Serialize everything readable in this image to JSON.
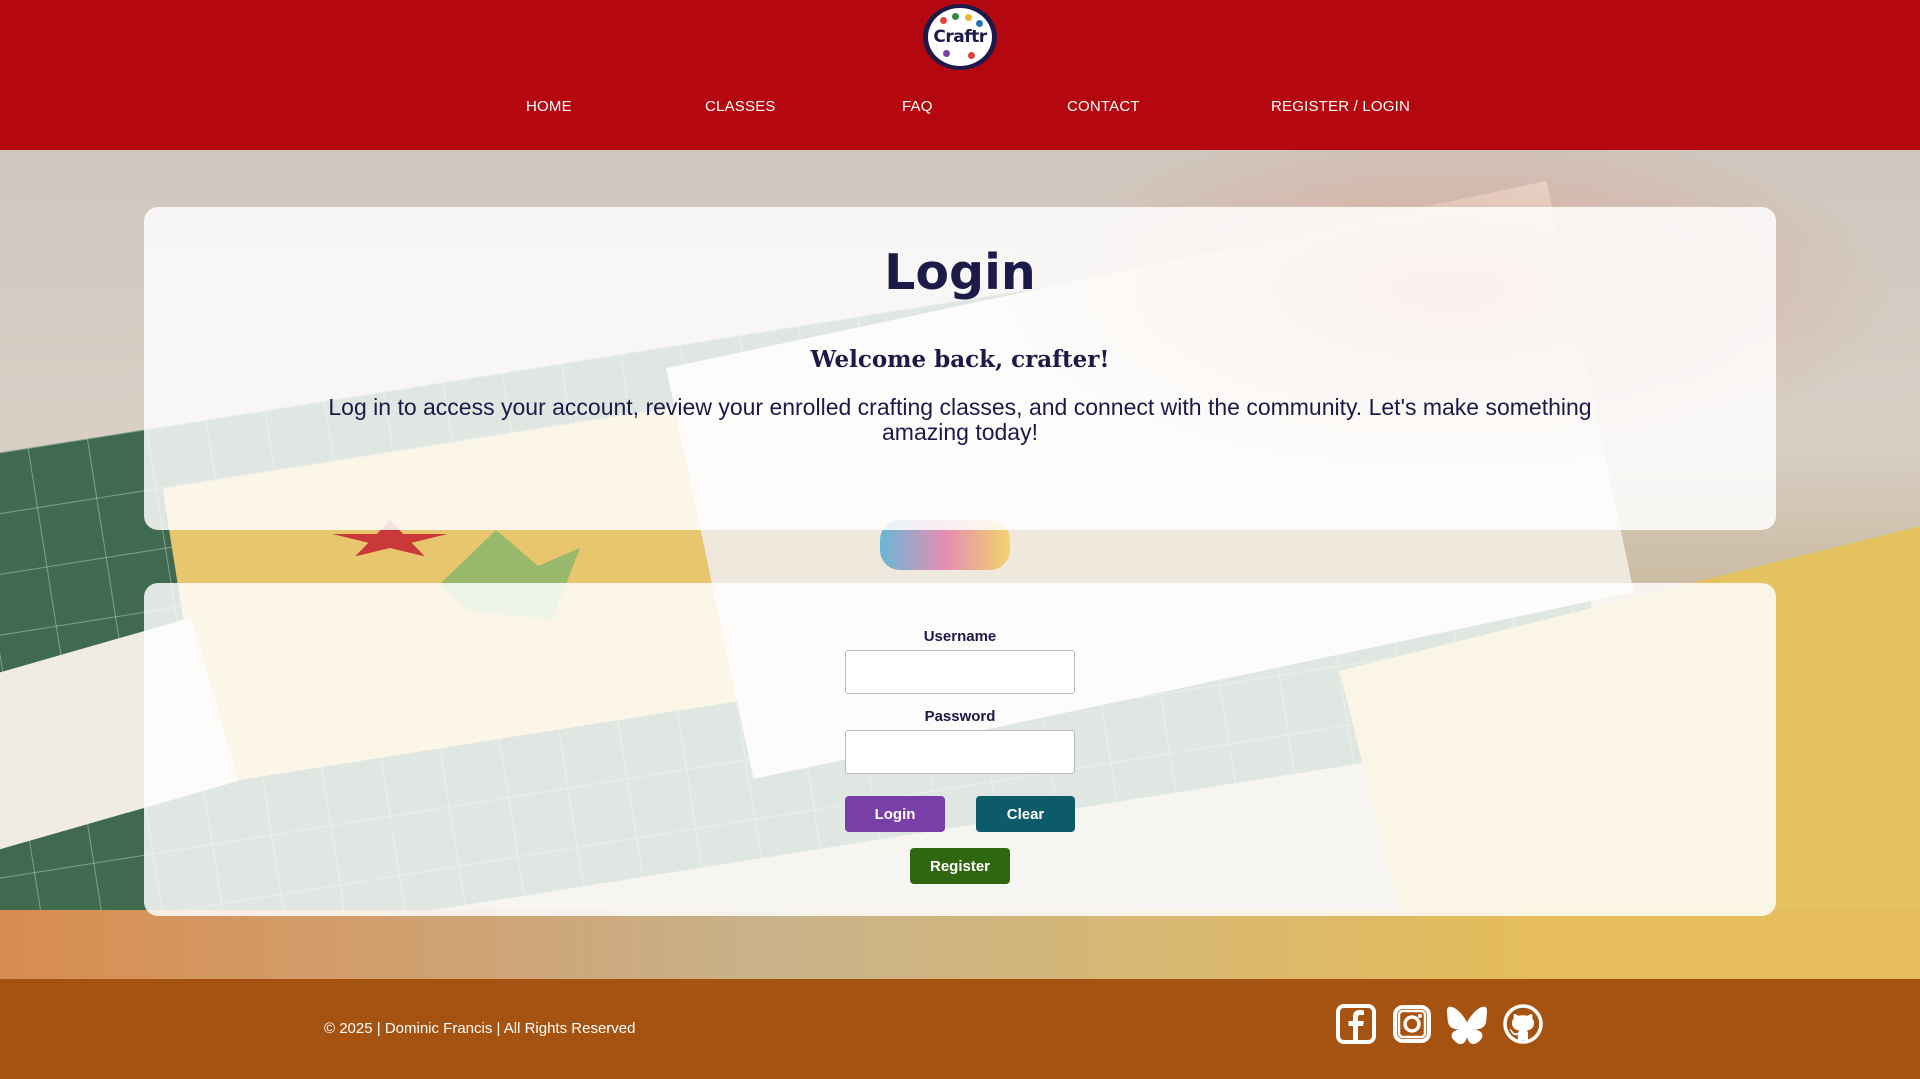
{
  "header": {
    "logo_text": "Craftr",
    "nav": [
      {
        "label": "HOME"
      },
      {
        "label": "CLASSES"
      },
      {
        "label": "FAQ"
      },
      {
        "label": "CONTACT"
      },
      {
        "label": "REGISTER / LOGIN"
      }
    ]
  },
  "intro": {
    "title": "Login",
    "welcome": "Welcome back, crafter!",
    "text": "Log in to access your account, review your enrolled crafting classes, and connect with the community. Let's make something amazing today!"
  },
  "form": {
    "username_label": "Username",
    "username_value": "",
    "password_label": "Password",
    "password_value": "",
    "login_button": "Login",
    "clear_button": "Clear",
    "register_button": "Register"
  },
  "footer": {
    "copyright": "© 2025 | Dominic Francis | All Rights Reserved",
    "social_icons": [
      "facebook-icon",
      "instagram-icon",
      "bluesky-icon",
      "github-icon"
    ]
  },
  "colors": {
    "header_bg": "#b4070f",
    "footer_bg": "#a65312",
    "title_text": "#1b1a48",
    "login_button": "#7a3fa6",
    "clear_button": "#0d5b6a",
    "register_button": "#2f6612"
  }
}
